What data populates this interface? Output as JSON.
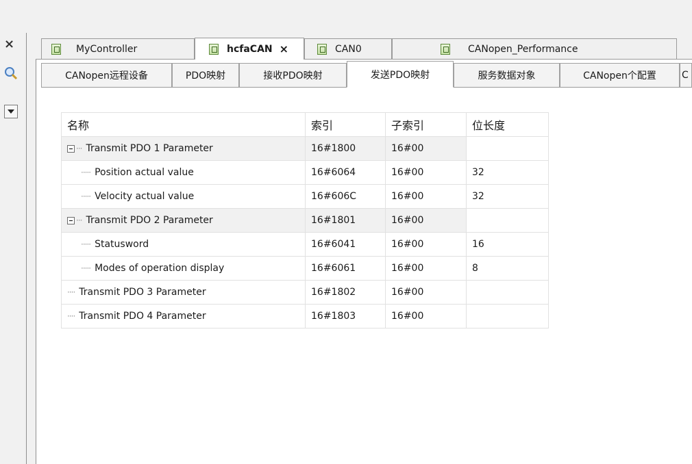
{
  "window": {
    "close_glyph": "×"
  },
  "doc_tabs": [
    {
      "label": "MyController",
      "active": false
    },
    {
      "label": "hcfaCAN",
      "active": true,
      "close": "×"
    },
    {
      "label": "CAN0",
      "active": false
    },
    {
      "label": "CANopen_Performance",
      "active": false
    }
  ],
  "sub_tabs": [
    {
      "label": "CANopen远程设备"
    },
    {
      "label": "PDO映射"
    },
    {
      "label": "接收PDO映射"
    },
    {
      "label": "发送PDO映射",
      "active": true
    },
    {
      "label": "服务数据对象"
    },
    {
      "label": "CANopen个配置"
    },
    {
      "label": "C"
    }
  ],
  "table": {
    "columns": [
      "名称",
      "索引",
      "子索引",
      "位长度"
    ],
    "rows": [
      {
        "name": "Transmit PDO 1 Parameter",
        "index": "16#1800",
        "subindex": "16#00",
        "bitlen": "",
        "level": 0,
        "expander": "-"
      },
      {
        "name": "Position actual value",
        "index": "16#6064",
        "subindex": "16#00",
        "bitlen": "32",
        "level": 1
      },
      {
        "name": "Velocity actual value",
        "index": "16#606C",
        "subindex": "16#00",
        "bitlen": "32",
        "level": 1
      },
      {
        "name": "Transmit PDO 2 Parameter",
        "index": "16#1801",
        "subindex": "16#00",
        "bitlen": "",
        "level": 0,
        "expander": "-"
      },
      {
        "name": "Statusword",
        "index": "16#6041",
        "subindex": "16#00",
        "bitlen": "16",
        "level": 1
      },
      {
        "name": "Modes of operation display",
        "index": "16#6061",
        "subindex": "16#00",
        "bitlen": "8",
        "level": 1
      },
      {
        "name": "Transmit PDO 3 Parameter",
        "index": "16#1802",
        "subindex": "16#00",
        "bitlen": "",
        "level": 0
      },
      {
        "name": "Transmit PDO 4 Parameter",
        "index": "16#1803",
        "subindex": "16#00",
        "bitlen": "",
        "level": 0
      }
    ]
  }
}
